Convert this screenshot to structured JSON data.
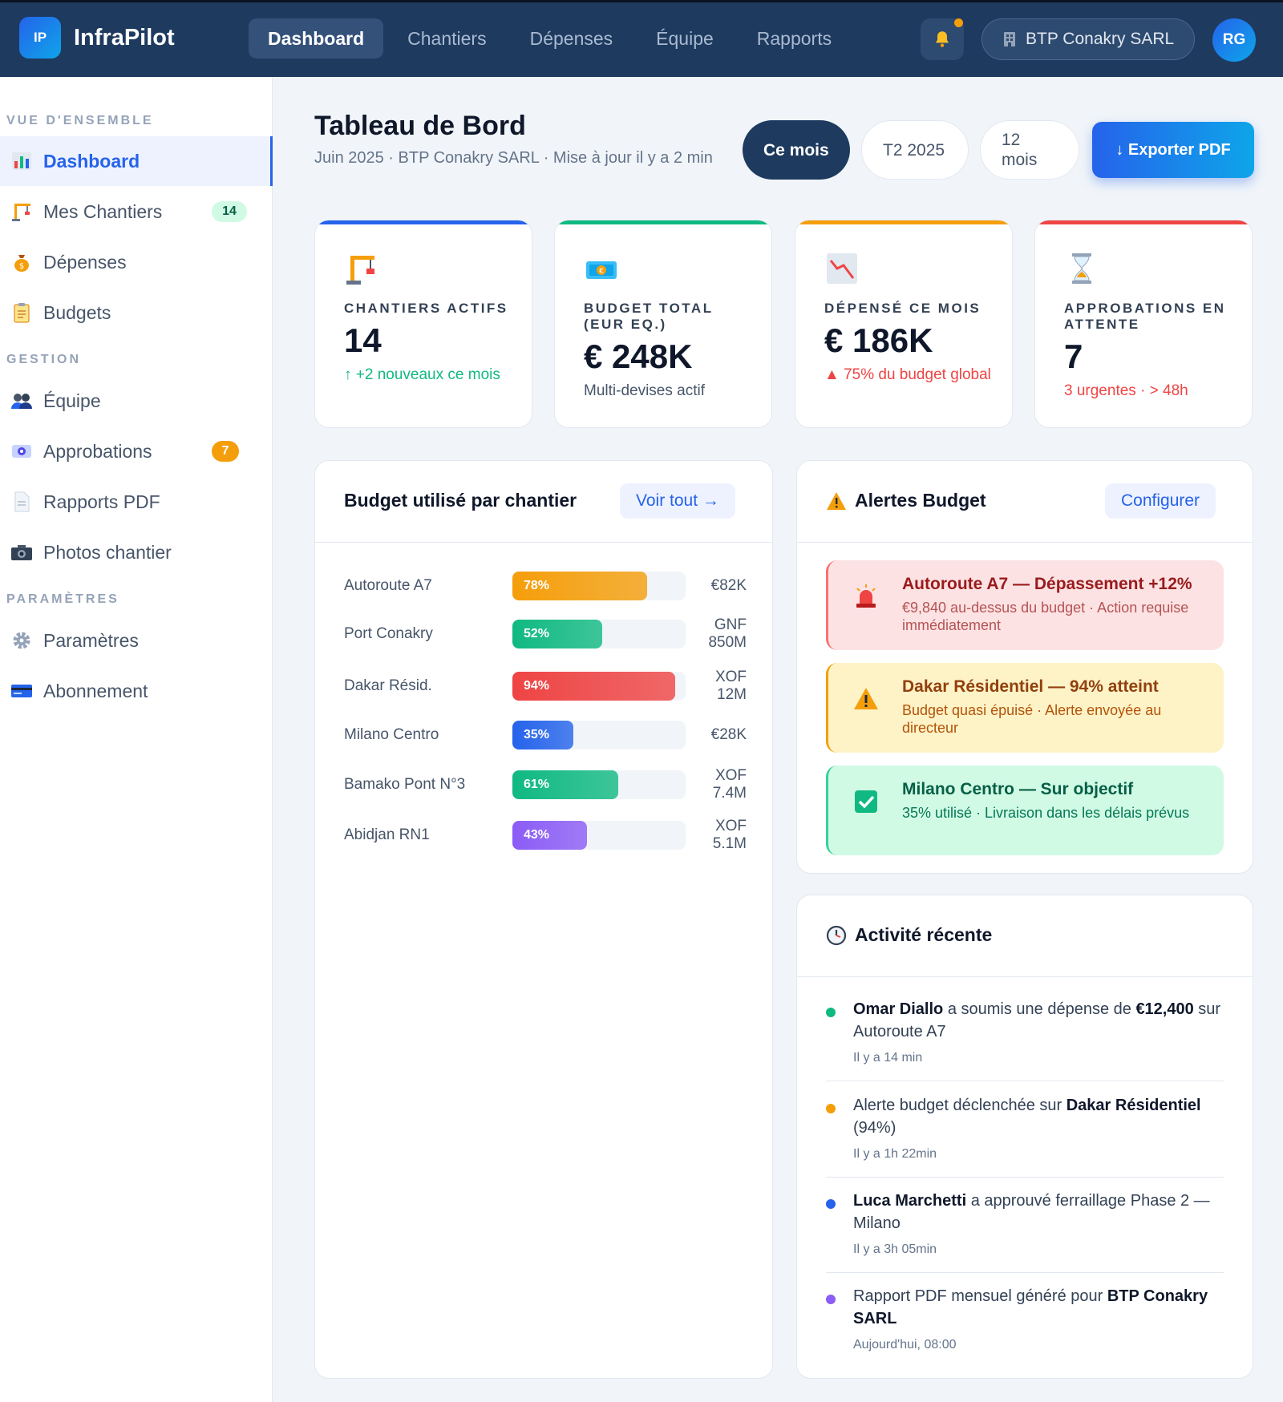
{
  "app": {
    "logo_initials": "IP",
    "name": "InfraPilot"
  },
  "nav": [
    {
      "label": "Dashboard",
      "active": true
    },
    {
      "label": "Chantiers",
      "active": false
    },
    {
      "label": "Dépenses",
      "active": false
    },
    {
      "label": "Équipe",
      "active": false
    },
    {
      "label": "Rapports",
      "active": false
    }
  ],
  "topbar": {
    "bell_icon": "bell-icon",
    "org_name": "BTP Conakry SARL",
    "avatar_initials": "RG"
  },
  "sidebar": {
    "sections": [
      {
        "title": "VUE D'ENSEMBLE"
      },
      {
        "title": "GESTION"
      },
      {
        "title": "PARAMÈTRES"
      }
    ],
    "items": [
      {
        "label": "Dashboard",
        "icon": "chart-icon",
        "active": true
      },
      {
        "label": "Mes Chantiers",
        "icon": "crane-icon",
        "badge": "14"
      },
      {
        "label": "Dépenses",
        "icon": "money-bag-icon"
      },
      {
        "label": "Budgets",
        "icon": "clipboard-icon"
      },
      {
        "label": "Équipe",
        "icon": "team-icon"
      },
      {
        "label": "Approbations",
        "icon": "approval-icon",
        "badge": "7"
      },
      {
        "label": "Rapports PDF",
        "icon": "document-icon"
      },
      {
        "label": "Photos chantier",
        "icon": "camera-icon"
      },
      {
        "label": "Paramètres",
        "icon": "gear-icon"
      },
      {
        "label": "Abonnement",
        "icon": "card-icon"
      }
    ]
  },
  "header": {
    "title": "Tableau de Bord",
    "subtitle": "Juin 2025 · BTP Conakry SARL · Mise à jour il y a 2 min",
    "periods": [
      {
        "label": "Ce mois",
        "active": true
      },
      {
        "label": "T2 2025",
        "active": false
      },
      {
        "label": "12 mois",
        "active": false
      }
    ],
    "export_label": "↓ Exporter PDF"
  },
  "kpis": [
    {
      "label": "CHANTIERS ACTIFS",
      "value": "14",
      "note": "↑ +2 nouveaux ce mois",
      "color": "#2563eb",
      "note_color": "#10b981",
      "icon": "crane-icon"
    },
    {
      "label": "BUDGET TOTAL (EUR EQ.)",
      "value": "€ 248K",
      "note": "Multi-devises actif",
      "color": "#10b981",
      "note_color": "#475569",
      "icon": "money-icon"
    },
    {
      "label": "DÉPENSÉ CE MOIS",
      "value": "€ 186K",
      "note": "▲ 75% du budget global",
      "color": "#f59e0b",
      "note_color": "#ef4444",
      "icon": "chart-down-icon"
    },
    {
      "label": "APPROBATIONS EN ATTENTE",
      "value": "7",
      "note": "3 urgentes · > 48h",
      "color": "#ef4444",
      "note_color": "#ef4444",
      "icon": "hourglass-icon"
    }
  ],
  "budget_panel": {
    "title": "Budget utilisé par chantier",
    "action": "Voir tout →"
  },
  "chart_data": {
    "type": "bar",
    "categories": [
      "Autoroute A7",
      "Port Conakry",
      "Dakar Résid.",
      "Milano Centro",
      "Bamako Pont N°3",
      "Abidjan RN1"
    ],
    "values": [
      78,
      52,
      94,
      35,
      61,
      43
    ],
    "value_labels": [
      "78%",
      "52%",
      "94%",
      "35%",
      "61%",
      "43%"
    ],
    "amounts": [
      "€82K",
      "GNF 850M",
      "XOF 12M",
      "€28K",
      "XOF 7.4M",
      "XOF 5.1M"
    ],
    "colors": [
      "#f59e0b",
      "#10b981",
      "#ef4444",
      "#2563eb",
      "#10b981",
      "#8b5cf6"
    ],
    "ylim": [
      0,
      100
    ]
  },
  "alerts_panel": {
    "title": "Alertes Budget",
    "icon": "warning-icon",
    "action": "Configurer",
    "alerts": [
      {
        "title": "Autoroute A7 — Dépassement +12%",
        "text": "€9,840 au-dessus du budget · Action requise immédiatement",
        "icon": "siren-icon",
        "bg": "#fde2e4",
        "border": "#f87171",
        "title_color": "#991b1b",
        "text_color": "#b45353"
      },
      {
        "title": "Dakar Résidentiel — 94% atteint",
        "text": "Budget quasi épuisé · Alerte envoyée au directeur",
        "icon": "warning-icon",
        "bg": "#fef3c7",
        "border": "#f59e0b",
        "title_color": "#92400e",
        "text_color": "#b45309"
      },
      {
        "title": "Milano Centro — Sur objectif",
        "text": "35% utilisé · Livraison dans les délais prévus",
        "icon": "check-icon",
        "bg": "#d1fae5",
        "border": "#34d399",
        "title_color": "#065f46",
        "text_color": "#047857"
      }
    ]
  },
  "activity_panel": {
    "title": "Activité récente",
    "icon": "clock-icon",
    "items": [
      {
        "parts": [
          {
            "t": "Omar Diallo",
            "b": true
          },
          {
            "t": " a soumis une dépense de ",
            "b": false
          },
          {
            "t": "€12,400",
            "b": true
          },
          {
            "t": " sur Autoroute A7",
            "b": false
          }
        ],
        "time": "Il y a 14 min",
        "dot": "#10b981"
      },
      {
        "parts": [
          {
            "t": "Alerte budget déclenchée sur ",
            "b": false
          },
          {
            "t": "Dakar Résidentiel",
            "b": true
          },
          {
            "t": " (94%)",
            "b": false
          }
        ],
        "time": "Il y a 1h 22min",
        "dot": "#f59e0b"
      },
      {
        "parts": [
          {
            "t": "Luca Marchetti",
            "b": true
          },
          {
            "t": " a approuvé ferraillage Phase 2 — Milano",
            "b": false
          }
        ],
        "time": "Il y a 3h 05min",
        "dot": "#2563eb"
      },
      {
        "parts": [
          {
            "t": "Rapport PDF mensuel généré pour ",
            "b": false
          },
          {
            "t": "BTP Conakry SARL",
            "b": true
          }
        ],
        "time": "Aujourd'hui, 08:00",
        "dot": "#8b5cf6"
      }
    ]
  }
}
